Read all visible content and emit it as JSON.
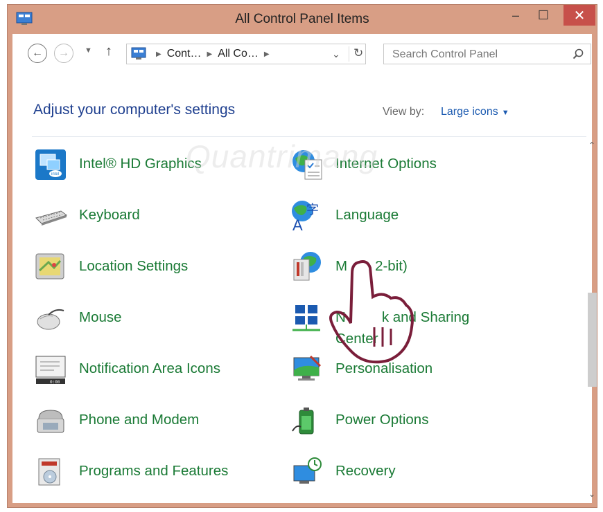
{
  "window": {
    "title": "All Control Panel Items",
    "controls": {
      "minimize": "–",
      "maximize": "☐",
      "close": "✕"
    }
  },
  "navigation": {
    "back_icon": "back-arrow-icon",
    "forward_icon": "forward-arrow-icon",
    "recent_icon": "chevron-down-icon",
    "up_icon": "up-arrow-icon",
    "breadcrumbs": [
      "Cont…",
      "All Co…"
    ],
    "address_dropdown": "⌄",
    "refresh": "↻"
  },
  "search": {
    "placeholder": "Search Control Panel"
  },
  "header": {
    "heading": "Adjust your computer's settings",
    "view_by_label": "View by:",
    "view_by_value": "Large icons"
  },
  "items": [
    {
      "label": "Intel® HD Graphics",
      "icon": "intel-graphics-icon"
    },
    {
      "label": "Internet Options",
      "icon": "internet-options-icon"
    },
    {
      "label": "Keyboard",
      "icon": "keyboard-icon"
    },
    {
      "label": "Language",
      "icon": "language-icon"
    },
    {
      "label": "Location Settings",
      "icon": "location-settings-icon"
    },
    {
      "label": "M",
      "label_tail": "2-bit)",
      "icon": "mail-icon"
    },
    {
      "label": "Mouse",
      "icon": "mouse-icon"
    },
    {
      "label": "N",
      "label_tail": "k and Sharing",
      "label_line2": "Center",
      "icon": "network-sharing-icon"
    },
    {
      "label": "Notification Area Icons",
      "icon": "notification-area-icon"
    },
    {
      "label": "Personalisation",
      "icon": "personalisation-icon"
    },
    {
      "label": "Phone and Modem",
      "icon": "phone-modem-icon"
    },
    {
      "label": "Power Options",
      "icon": "power-options-icon"
    },
    {
      "label": "Programs and Features",
      "icon": "programs-features-icon"
    },
    {
      "label": "Recovery",
      "icon": "recovery-icon"
    }
  ],
  "watermark": "Quantrimang",
  "colors": {
    "link_green": "#1a7a35",
    "heading_blue": "#1e3f8f",
    "title_bar": "#d89e85",
    "close_red": "#c7504a"
  }
}
